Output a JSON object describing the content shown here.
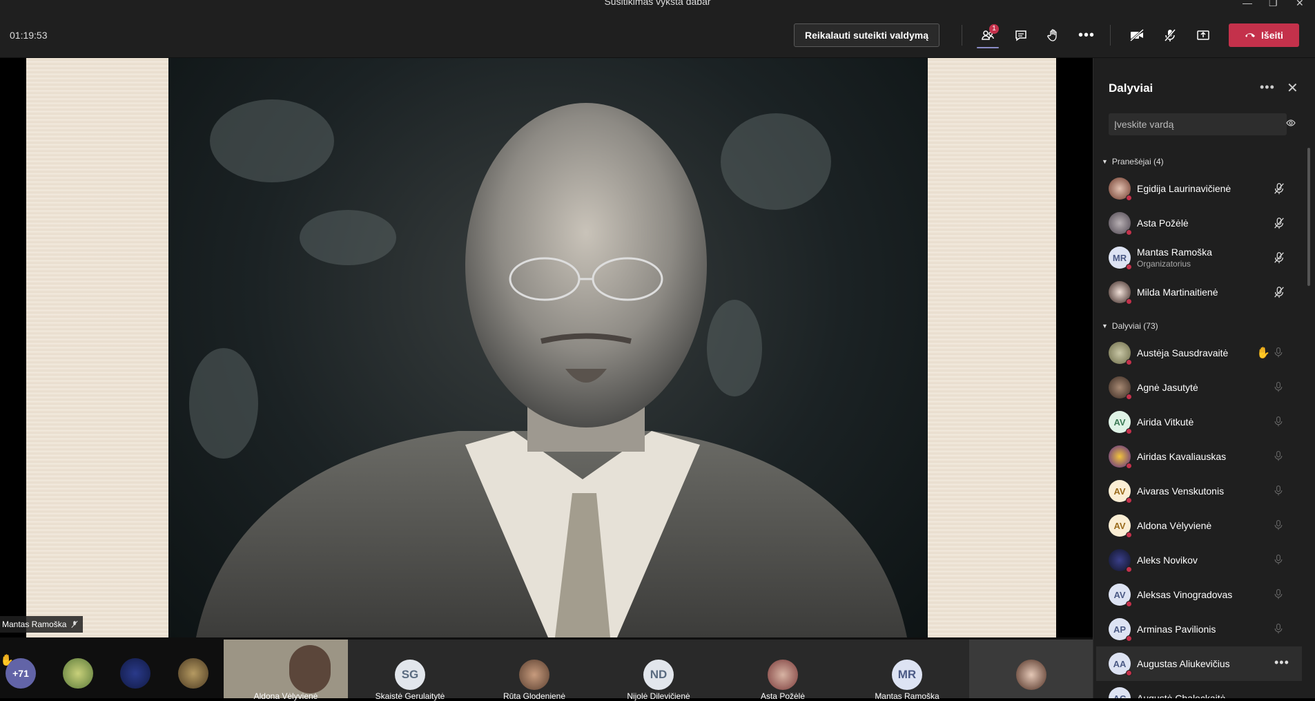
{
  "window": {
    "title": "Susitikimas vyksta dabar"
  },
  "toolbar": {
    "timer": "01:19:53",
    "control_request_label": "Reikalauti suteikti valdymą",
    "people_badge": "1",
    "leave_label": "Išeiti"
  },
  "stage": {
    "speaker_label": "Mantas Ramoška"
  },
  "gallery": {
    "overflow_count": "+71",
    "tiles": [
      {
        "name": "Aldona Vėlyvienė",
        "initials": ""
      },
      {
        "name": "Skaistė Gerulaitytė",
        "initials": "SG"
      },
      {
        "name": "Rūta Glodenienė",
        "initials": ""
      },
      {
        "name": "Nijolė Dilevičienė",
        "initials": "ND"
      },
      {
        "name": "Asta Požėlė",
        "initials": ""
      },
      {
        "name": "Mantas Ramoška",
        "initials": "MR"
      }
    ]
  },
  "panel": {
    "title": "Dalyviai",
    "search_placeholder": "Įveskite vardą",
    "presenters_heading": "Pranešėjai (4)",
    "attendees_heading": "Dalyviai (73)",
    "presenters": [
      {
        "name": "Egidija Laurinavičienė",
        "initials": ""
      },
      {
        "name": "Asta Požėlė",
        "initials": ""
      },
      {
        "name": "Mantas Ramoška",
        "initials": "MR",
        "role": "Organizatorius"
      },
      {
        "name": "Milda Martinaitienė",
        "initials": ""
      }
    ],
    "attendees": [
      {
        "name": "Austėja Sausdravaitė",
        "initials": ""
      },
      {
        "name": "Agnė Jasutytė",
        "initials": ""
      },
      {
        "name": "Airida Vitkutė",
        "initials": "AV"
      },
      {
        "name": "Airidas Kavaliauskas",
        "initials": ""
      },
      {
        "name": "Aivaras Venskutonis",
        "initials": "AV"
      },
      {
        "name": "Aldona Vėlyvienė",
        "initials": "AV"
      },
      {
        "name": "Aleks Novikov",
        "initials": ""
      },
      {
        "name": "Aleksas Vinogradovas",
        "initials": "AV"
      },
      {
        "name": "Arminas Pavilionis",
        "initials": "AP"
      },
      {
        "name": "Augustas Aliukevičius",
        "initials": "AA"
      },
      {
        "name": "Augustė Chaleckaitė",
        "initials": "AC"
      }
    ]
  },
  "colors": {
    "accent": "#6264a7",
    "leave": "#c4314b",
    "panel_bg": "#1f1f1f"
  }
}
